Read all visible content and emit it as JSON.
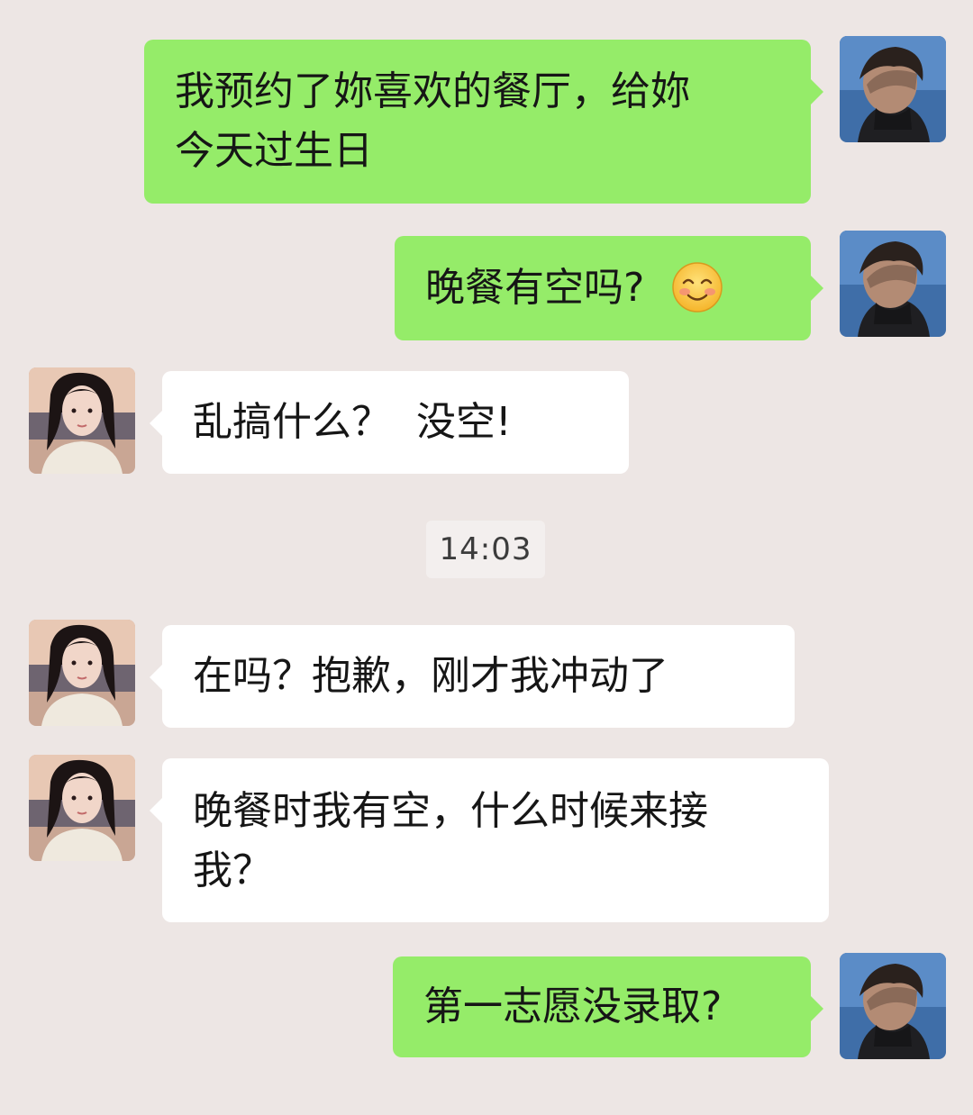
{
  "messages": [
    {
      "side": "out",
      "lines": [
        "我预约了妳喜欢的餐厅，给妳",
        "今天过生日"
      ]
    },
    {
      "side": "out",
      "text": "晚餐有空吗?",
      "emoji": "smiling-face-icon"
    },
    {
      "side": "in",
      "text": "乱搞什么？  没空!"
    },
    {
      "side": "in",
      "text": "在吗？抱歉，刚才我冲动了"
    },
    {
      "side": "in",
      "lines": [
        "晚餐时我有空，什么时候来接",
        "我？"
      ]
    },
    {
      "side": "out",
      "text": "第一志愿没录取?"
    }
  ],
  "timestamp": "14:03",
  "colors": {
    "background": "#ede6e4",
    "outgoing_bubble": "#95ec69",
    "incoming_bubble": "#ffffff"
  }
}
